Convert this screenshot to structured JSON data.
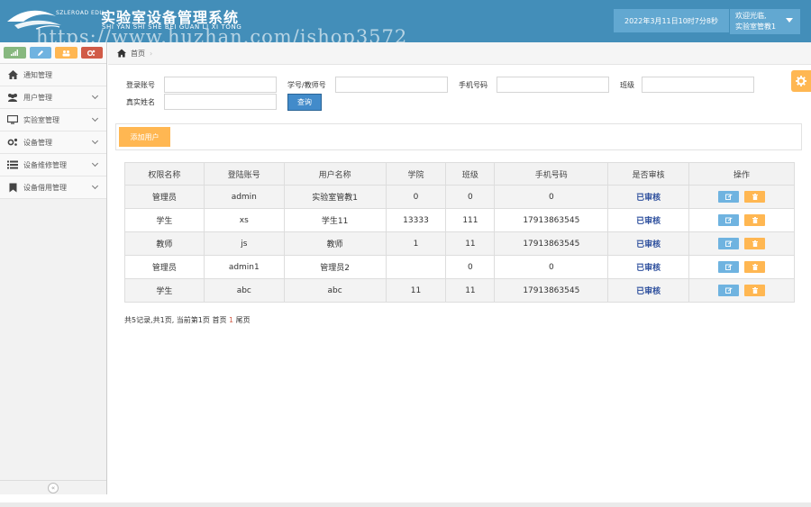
{
  "header": {
    "logo_text": "SZLEROAD EDU",
    "title": "实验室设备管理系统",
    "pinyin": "SHI YAN SHI SHE BEI GUAN LI XI TONG",
    "watermark": "https://www.huzhan.com/ishop3572",
    "datetime": "2022年3月11日10时7分8秒",
    "welcome": "欢迎光临,",
    "username": "实验室管教1"
  },
  "sidebar": {
    "items": [
      {
        "label": "通知管理",
        "icon": "home-icon"
      },
      {
        "label": "用户管理",
        "icon": "users-icon"
      },
      {
        "label": "实验室管理",
        "icon": "desktop-icon"
      },
      {
        "label": "设备管理",
        "icon": "gears-icon"
      },
      {
        "label": "设备维修管理",
        "icon": "list-icon"
      },
      {
        "label": "设备借用管理",
        "icon": "bookmark-icon"
      }
    ]
  },
  "breadcrumb": {
    "home": "首页"
  },
  "search": {
    "login_label": "登录账号",
    "student_label": "学号/教师号",
    "phone_label": "手机号码",
    "class_label": "班级",
    "realname_label": "真实姓名",
    "login_value": "",
    "student_value": "",
    "phone_value": "",
    "class_value": "",
    "realname_value": "",
    "query_label": "查询"
  },
  "toolbar": {
    "add_label": "添加用户"
  },
  "table": {
    "headers": [
      "权限名称",
      "登陆账号",
      "用户名称",
      "学院",
      "班级",
      "手机号码",
      "是否审核",
      "操作"
    ],
    "rows": [
      [
        "管理员",
        "admin",
        "实验室管教1",
        "0",
        "0",
        "0",
        "已审核"
      ],
      [
        "学生",
        "xs",
        "学生11",
        "13333",
        "111",
        "17913863545",
        "已审核"
      ],
      [
        "教师",
        "js",
        "教师",
        "1",
        "11",
        "17913863545",
        "已审核"
      ],
      [
        "管理员",
        "admin1",
        "管理员2",
        "",
        "0",
        "0",
        "已审核"
      ],
      [
        "学生",
        "abc",
        "abc",
        "11",
        "11",
        "17913863545",
        "已审核"
      ]
    ]
  },
  "pager": {
    "summary": "共5记录,共1页, 当前第1页 首页 ",
    "current": "1",
    "last": " 尾页"
  },
  "colors": {
    "header_bg": "#438eb9",
    "accent_orange": "#ffb752",
    "primary_blue": "#428bca",
    "status_blue": "#2b4d9c"
  }
}
